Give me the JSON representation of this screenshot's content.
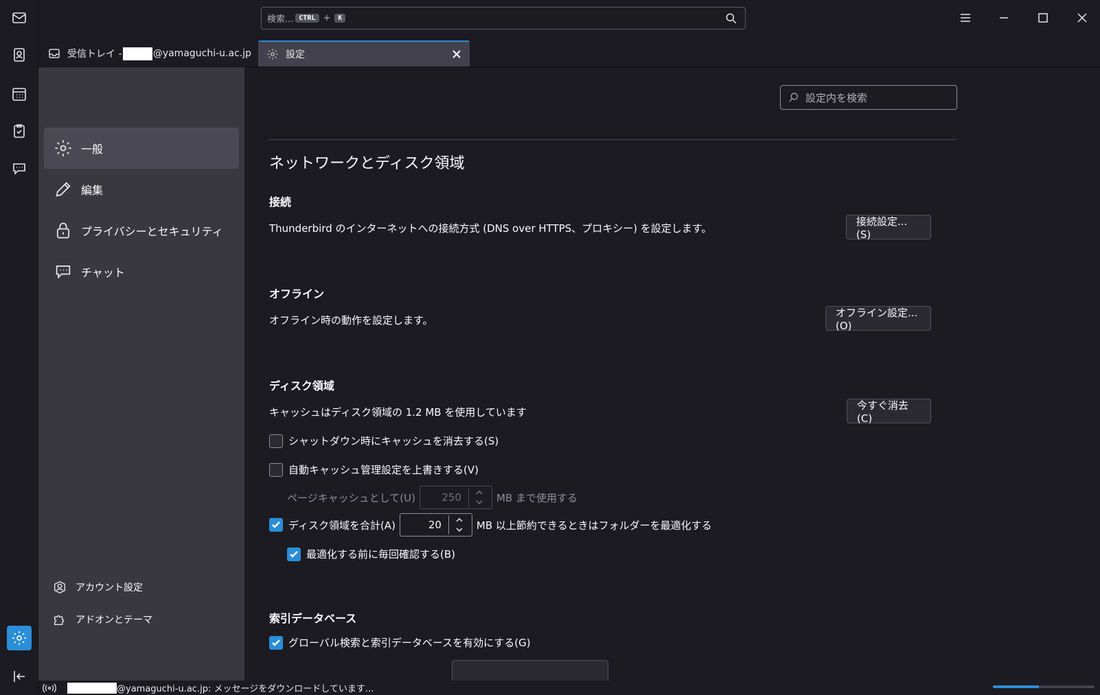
{
  "search": {
    "placeholder": "検索...",
    "key1": "CTRL",
    "plus": "+",
    "key2": "K"
  },
  "tabs": [
    {
      "label_prefix": "受信トレイ - ",
      "label_suffix": "@yamaguchi-u.ac.jp"
    },
    {
      "label": "設定"
    }
  ],
  "nav": {
    "items": [
      {
        "label": "一般"
      },
      {
        "label": "編集"
      },
      {
        "label": "プライバシーとセキュリティ"
      },
      {
        "label": "チャット"
      }
    ],
    "account_settings": "アカウント設定",
    "addons": "アドオンとテーマ"
  },
  "main": {
    "find_placeholder": "設定内を検索",
    "section_title": "ネットワークとディスク領域",
    "connection": {
      "title": "接続",
      "desc": "Thunderbird のインターネットへの接続方式 (DNS over HTTPS、プロキシー) を設定します。",
      "button": "接続設定...(S)"
    },
    "offline": {
      "title": "オフライン",
      "desc": "オフライン時の動作を設定します。",
      "button": "オフライン設定...(O)"
    },
    "disk": {
      "title": "ディスク領域",
      "desc": "キャッシュはディスク領域の 1.2 MB を使用しています",
      "button": "今すぐ消去(C)",
      "clear_on_shutdown": "シャットダウン時にキャッシュを消去する(S)",
      "override_cache": "自動キャッシュ管理設定を上書きする(V)",
      "page_cache_label": "ページキャッシュとして(U)",
      "page_cache_value": "250",
      "page_cache_unit": "MB まで使用する",
      "compact_label": "ディスク領域を合計(A)",
      "compact_value": "20",
      "compact_unit": "MB 以上節約できるときはフォルダーを最適化する",
      "confirm_compact": "最適化する前に毎回確認する(B)"
    },
    "index": {
      "title": "索引データベース",
      "enable_global_search": "グローバル検索と索引データベースを有効にする(G)"
    }
  },
  "status": {
    "suffix": "@yamaguchi-u.ac.jp: メッセージをダウンロードしています...",
    "progress": 0.45
  },
  "colors": {
    "accent": "#2a8ed8",
    "background": "#1c1b22",
    "sidebar": "#393840"
  }
}
